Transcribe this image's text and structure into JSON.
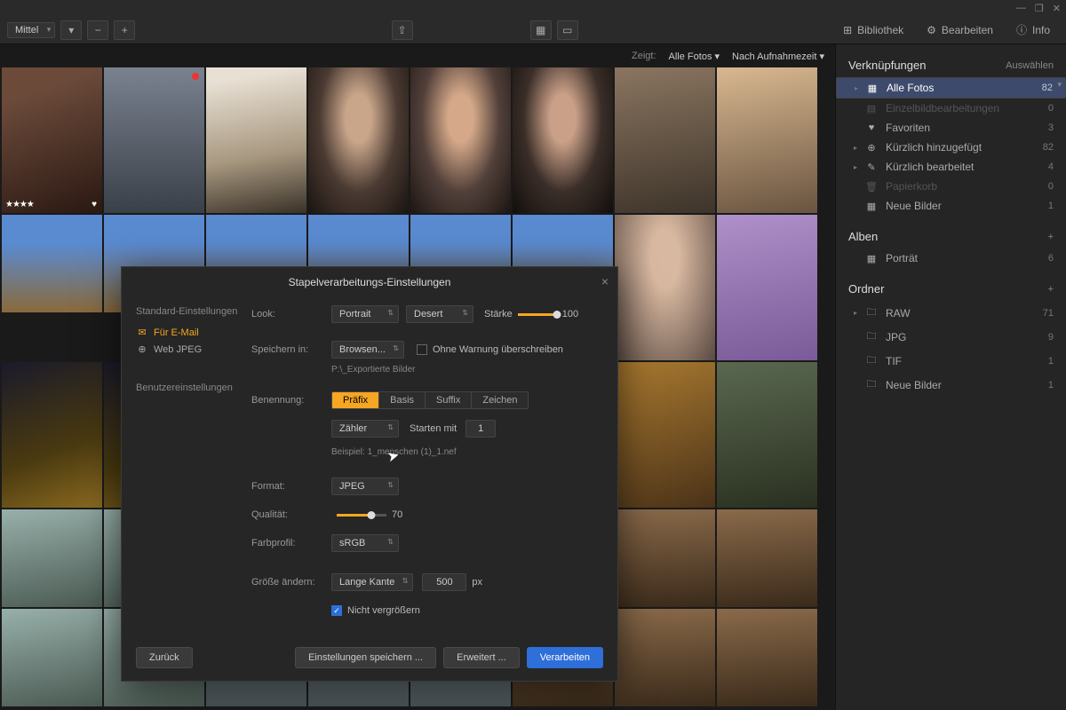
{
  "window": {
    "min": "—",
    "max": "❐",
    "close": "✕"
  },
  "toolbar": {
    "zoom": "Mittel",
    "library": "Bibliothek",
    "edit": "Bearbeiten",
    "info": "Info"
  },
  "filter": {
    "shows_label": "Zeigt:",
    "shows_value": "Alle Fotos",
    "sort_value": "Nach Aufnahmezeit"
  },
  "sidebar": {
    "links_h": "Verknüpfungen",
    "links_action": "Auswählen",
    "items": [
      {
        "ic": "▦",
        "txt": "Alle Fotos",
        "cnt": "82",
        "sel": true,
        "tri": "▸"
      },
      {
        "ic": "▤",
        "txt": "Einzelbildbearbeitungen",
        "cnt": "0",
        "dis": true
      },
      {
        "ic": "♥",
        "txt": "Favoriten",
        "cnt": "3"
      },
      {
        "ic": "⊕",
        "txt": "Kürzlich hinzugefügt",
        "cnt": "82",
        "tri": "▸"
      },
      {
        "ic": "✎",
        "txt": "Kürzlich bearbeitet",
        "cnt": "4",
        "tri": "▸"
      },
      {
        "ic": "🗑",
        "txt": "Papierkorb",
        "cnt": "0",
        "dis": true
      },
      {
        "ic": "▦",
        "txt": "Neue Bilder",
        "cnt": "1"
      }
    ],
    "albums_h": "Alben",
    "albums": [
      {
        "ic": "▦",
        "txt": "Porträt",
        "cnt": "6"
      }
    ],
    "folders_h": "Ordner",
    "folders": [
      {
        "ic": "🗀",
        "txt": "RAW",
        "cnt": "71",
        "tri": "▸"
      },
      {
        "ic": "🗀",
        "txt": "JPG",
        "cnt": "9"
      },
      {
        "ic": "🗀",
        "txt": "TIF",
        "cnt": "1"
      },
      {
        "ic": "🗀",
        "txt": "Neue Bilder",
        "cnt": "1"
      }
    ]
  },
  "dialog": {
    "title": "Stapelverarbeitungs-Einstellungen",
    "left": {
      "std": "Standard-Einstellungen",
      "email": "Für E-Mail",
      "webjpeg": "Web JPEG",
      "user": "Benutzereinstellungen"
    },
    "look": {
      "label": "Look:",
      "preset": "Portrait",
      "preset2": "Desert",
      "strength_label": "Stärke",
      "strength": "100"
    },
    "save": {
      "label": "Speichern in:",
      "browse": "Browsen...",
      "overwrite": "Ohne Warnung überschreiben",
      "path": "P:\\_Exportierte Bilder"
    },
    "naming": {
      "label": "Benennung:",
      "tabs": [
        "Präfix",
        "Basis",
        "Suffix",
        "Zeichen"
      ],
      "counter": "Zähler",
      "startwith": "Starten mit",
      "startval": "1",
      "example": "Beispiel: 1_menschen (1)_1.nef"
    },
    "format": {
      "label": "Format:",
      "value": "JPEG",
      "quality_label": "Qualität:",
      "quality": "70",
      "profile_label": "Farbprofil:",
      "profile": "sRGB"
    },
    "resize": {
      "label": "Größe ändern:",
      "mode": "Lange Kante",
      "px": "500",
      "unit": "px",
      "noenlarge": "Nicht vergrößern"
    },
    "buttons": {
      "back": "Zurück",
      "savepreset": "Einstellungen speichern ...",
      "advanced": "Erweitert ...",
      "process": "Verarbeiten"
    }
  }
}
